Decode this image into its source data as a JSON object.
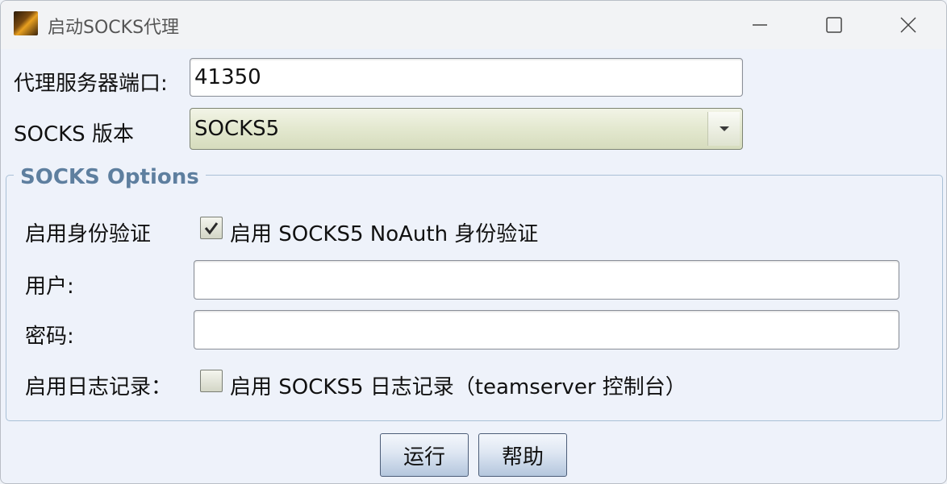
{
  "window": {
    "title": "启动SOCKS代理"
  },
  "form": {
    "port_label": "代理服务器端口:",
    "port_value": "41350",
    "version_label": "SOCKS 版本",
    "version_selected": "SOCKS5"
  },
  "options": {
    "group_title": "SOCKS Options",
    "auth_label": "启用身份验证",
    "auth_checkbox_label": "启用 SOCKS5 NoAuth 身份验证",
    "auth_checked": true,
    "user_label": "用户:",
    "user_value": "",
    "password_label": "密码:",
    "password_value": "",
    "logging_label": "启用日志记录：",
    "logging_checkbox_label": "启用 SOCKS5 日志记录（teamserver 控制台）",
    "logging_checked": false
  },
  "buttons": {
    "run": "运行",
    "help": "帮助"
  }
}
